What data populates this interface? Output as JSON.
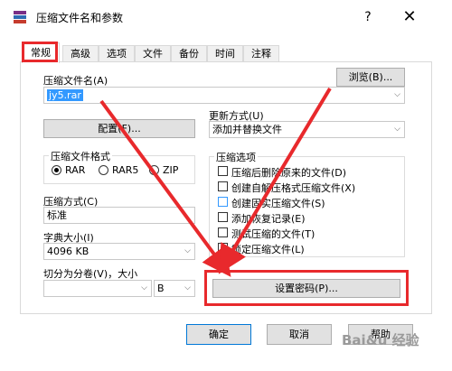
{
  "window": {
    "title": "压缩文件名和参数",
    "help_label": "?",
    "close_label": "✕"
  },
  "tabs": [
    {
      "label": "常规",
      "active": true
    },
    {
      "label": "高级",
      "active": false
    },
    {
      "label": "选项",
      "active": false
    },
    {
      "label": "文件",
      "active": false
    },
    {
      "label": "备份",
      "active": false
    },
    {
      "label": "时间",
      "active": false
    },
    {
      "label": "注释",
      "active": false
    }
  ],
  "general": {
    "archive_name_label": "压缩文件名(A)",
    "archive_name_value": "jy5.rar",
    "browse_label": "浏览(B)...",
    "profiles_label": "配置(F)...",
    "update_mode_label": "更新方式(U)",
    "update_mode_value": "添加并替换文件",
    "format_group_label": "压缩文件格式",
    "format_options": [
      "RAR",
      "RAR5",
      "ZIP"
    ],
    "format_selected": "RAR",
    "method_label": "压缩方式(C)",
    "method_value": "标准",
    "dict_label": "字典大小(I)",
    "dict_value": "4096 KB",
    "split_label": "切分为分卷(V)，大小",
    "split_value": "",
    "split_unit": "B",
    "options_group_label": "压缩选项",
    "options": [
      {
        "label": "压缩后删除原来的文件(D)",
        "checked": false
      },
      {
        "label": "创建自解压格式压缩文件(X)",
        "checked": false
      },
      {
        "label": "创建固实压缩文件(S)",
        "checked": false
      },
      {
        "label": "添加恢复记录(E)",
        "checked": false
      },
      {
        "label": "测试压缩的文件(T)",
        "checked": false
      },
      {
        "label": "锁定压缩文件(L)",
        "checked": false
      }
    ],
    "set_password_label": "设置密码(P)..."
  },
  "footer": {
    "ok_label": "确定",
    "cancel_label": "取消",
    "help_label": "帮助"
  },
  "watermark": "Bai&u 经验",
  "colors": {
    "accent_red": "#e8292c",
    "selection_blue": "#3399ff"
  },
  "icons": [
    "winrar-icon",
    "dropdown-arrow-icon",
    "close-icon"
  ]
}
